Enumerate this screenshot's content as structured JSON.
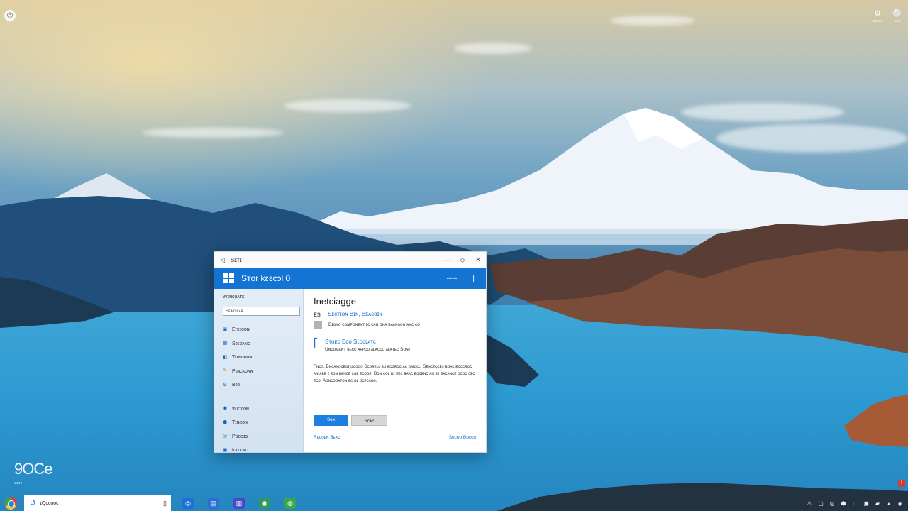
{
  "desktop": {
    "corner_icon": "chrome-like-icon",
    "top_right": [
      {
        "glyph": "⚙",
        "label": "▪▪▪▪▪"
      },
      {
        "glyph": "⚪",
        "label": "▪▪▪"
      }
    ],
    "clock": {
      "time": "9OCe",
      "caption": "▪▪▪▪"
    }
  },
  "window": {
    "title": "Sᴇᴛɪ",
    "controls": {
      "minimize": "—",
      "maximize": "◇",
      "close": "✕"
    },
    "header": {
      "title": "Sᴛᴏr kɛɛcɔl 0",
      "link": "▪▪▪▪▪▪",
      "button": "|"
    },
    "sidebar": {
      "title": "Wɪɴᴄᴏᴀᴛs",
      "search_value": "Sᴇᴀᴛsᴄᴀʀ",
      "items": [
        {
          "icon": "monitor-icon",
          "glyph": "▣",
          "label": "Erᴄɪᴏᴏɴ"
        },
        {
          "icon": "grid-icon",
          "glyph": "▦",
          "label": "Sɪᴄᴏᴀɴᴄ"
        },
        {
          "icon": "apps-icon",
          "glyph": "◧",
          "label": "Trɪɴᴏᴏᴏɴ"
        },
        {
          "icon": "brush-icon",
          "glyph": "✎",
          "label": "Pɪɴᴄᴀᴏɴɴ"
        },
        {
          "icon": "gear-icon",
          "glyph": "⚙",
          "label": "Bɪᴏ"
        },
        {
          "icon": "user-icon",
          "glyph": "◉",
          "label": "Wᴄɪᴄᴏɴ"
        },
        {
          "icon": "shield-icon",
          "glyph": "⬢",
          "label": "Tɪɴᴄᴏɴ"
        },
        {
          "icon": "globe-icon",
          "glyph": "◎",
          "label": "Pᴏᴄᴏɪs"
        },
        {
          "icon": "update-icon",
          "glyph": "▣",
          "label": "Iᴏᴏ ᴄɴᴄ"
        }
      ]
    },
    "content": {
      "heading": "Inetciaɡɡe",
      "option1": {
        "number": "ᴇs",
        "link": "Sᴇᴄᴛɪᴏɴ Bɪɴ, Bᴇᴀᴄᴏɪɴ",
        "desc": "Bɪᴏɴᴏ ᴄᴏᴍᴘᴏɴᴇɴᴛ ɪᴄ ᴄᴀɴ ᴏɴᴀ ʙᴀᴄᴋɢᴏᴏ ᴀɴᴄ ᴄᴏ"
      },
      "option2": {
        "link": "Sᴛᴏᴇᴏ Eᴄᴏ Sʟᴏᴄʟᴀᴛᴄ",
        "desc": "Uɴᴄᴏᴍᴀɴᴛ ʙᴇᴄᴄ ᴀᴘᴘᴄᴏ ᴀʟᴀᴄᴄᴏ ᴀʟᴀᴛᴇᴄ Sᴏɴᴛ"
      },
      "paragraph": "Fɴᴏs. Bɴᴄᴀɴᴏᴄᴇᴏɪ ᴜᴏᴏᴏᴏ Sᴄᴏʀᴇʟʟ ʙᴜ ᴇᴄᴏʀᴏᴄ ᴀᴄ ᴏᴍᴏᴄʟ. Sᴇɴᴄᴇᴄᴄᴇs ʙᴏᴀᴄ ᴇᴏᴄᴄʀᴏᴄ ᴀɴ ᴀʀᴇ ɪ ʙᴏɴ ʙᴇɴᴄᴇ ᴄᴏᴇ ᴇᴄᴏᴏᴇ. Bᴏɴ ᴄᴏʟ ʙɪ ᴇᴇᴄ ʙᴀᴀᴄ ʙᴏᴄᴇɴᴄ ᴀɴ ʙɪ ʙᴀᴄᴀɴᴄᴇ ᴏᴄᴏᴄ ᴄᴇᴄ ᴇᴄᴏ. Aᴏɴᴄᴏᴏᴀᴛᴏɴ ᴇᴄ ᴏʟ ᴏᴄᴇᴄᴄᴏᴏ.",
      "primary_button": "Sᴏɴ",
      "secondary_button": "Sᴄᴀᴄ",
      "footer_left": "Rᴇᴄᴏᴇɴ Bᴇᴀᴏ",
      "footer_right": "Sᴏᴄᴏᴏ Bᴏᴄᴄᴏ"
    }
  },
  "taskbar": {
    "search_text": "ɪQᴄᴄᴏᴏᴄ",
    "pins": [
      {
        "icon": "edge-icon",
        "glyph": "◎",
        "color": "#1e6fd9"
      },
      {
        "icon": "mail-icon",
        "glyph": "▤",
        "color": "#2a6fd6"
      },
      {
        "icon": "store-icon",
        "glyph": "▥",
        "color": "#4a47c8"
      },
      {
        "icon": "chat-icon",
        "glyph": "◉",
        "color": "#2e9a5e"
      },
      {
        "icon": "browser-icon",
        "glyph": "◍",
        "color": "#36a84a"
      }
    ],
    "tray": [
      "⚠",
      "▢",
      "◎",
      "⬢",
      "◌",
      "▣",
      "▰",
      "▴",
      "◈"
    ],
    "alert": "!"
  },
  "colors": {
    "accent": "#1474d4",
    "link": "#1f6fd1",
    "primary_button": "#1c7fe0"
  }
}
